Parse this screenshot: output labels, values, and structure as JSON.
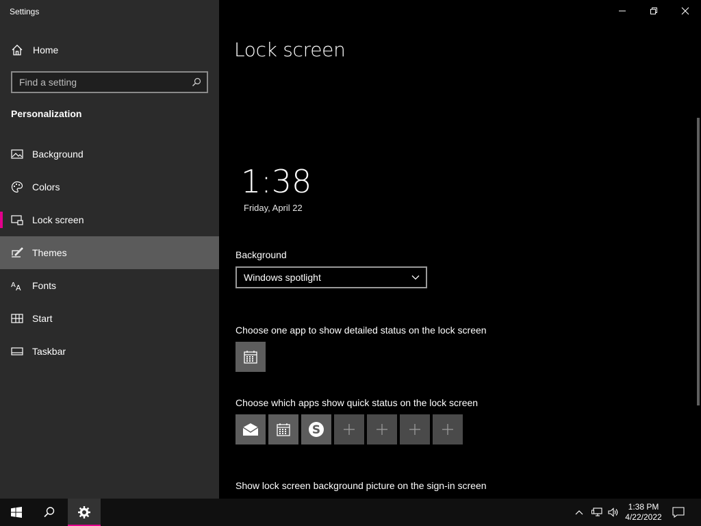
{
  "window": {
    "title": "Settings"
  },
  "sidebar": {
    "home_label": "Home",
    "search_placeholder": "Find a setting",
    "section_title": "Personalization",
    "items": [
      {
        "label": "Background",
        "icon": "picture-icon"
      },
      {
        "label": "Colors",
        "icon": "palette-icon"
      },
      {
        "label": "Lock screen",
        "icon": "lock-screen-icon",
        "selected": true
      },
      {
        "label": "Themes",
        "icon": "themes-icon",
        "hovered": true
      },
      {
        "label": "Fonts",
        "icon": "fonts-icon"
      },
      {
        "label": "Start",
        "icon": "start-icon"
      },
      {
        "label": "Taskbar",
        "icon": "taskbar-icon"
      }
    ]
  },
  "main": {
    "title": "Lock screen",
    "preview": {
      "time": "1:38",
      "date": "Friday, April 22"
    },
    "background_label": "Background",
    "background_value": "Windows spotlight",
    "detailed_status_label": "Choose one app to show detailed status on the lock screen",
    "quick_status_label": "Choose which apps show quick status on the lock screen",
    "signin_label": "Show lock screen background picture on the sign-in screen",
    "detailed_app": "calendar-icon",
    "quick_apps": [
      "mail-icon",
      "calendar-icon",
      "skype-icon",
      "plus-icon",
      "plus-icon",
      "plus-icon",
      "plus-icon"
    ]
  },
  "taskbar": {
    "time": "1:38 PM",
    "date": "4/22/2022"
  },
  "colors": {
    "accent": "#e3008c",
    "sidebar_bg": "#2b2b2b",
    "content_bg": "#000000"
  }
}
